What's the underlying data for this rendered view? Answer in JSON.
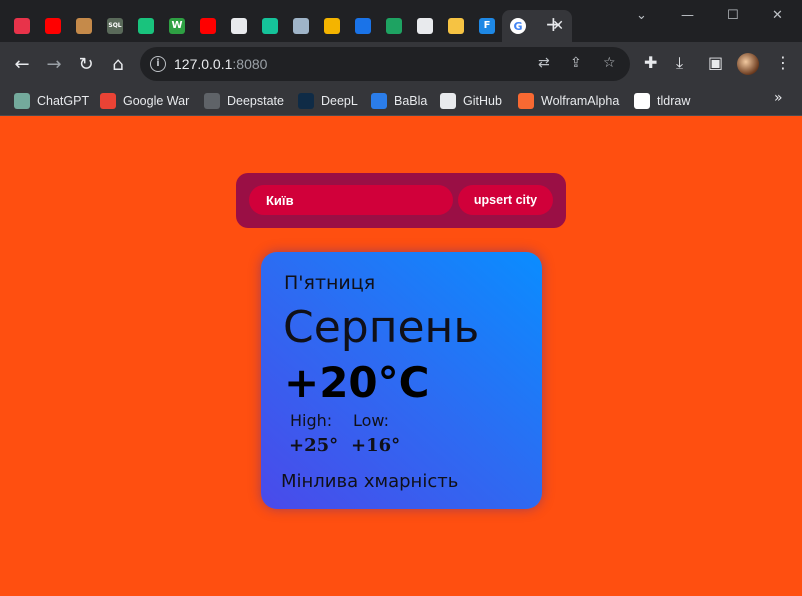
{
  "browser": {
    "tabs": [
      {
        "icon": "heart-icon",
        "color": "#e8334a"
      },
      {
        "icon": "youtube-icon",
        "color": "#ff0000"
      },
      {
        "icon": "box-icon",
        "color": "#c58a4a"
      },
      {
        "icon": "sql-icon",
        "color": "#5a6a5a",
        "glyph": "SQL"
      },
      {
        "icon": "openai-icon",
        "color": "#19c37d"
      },
      {
        "icon": "w-icon",
        "color": "#2ea043",
        "glyph": "W"
      },
      {
        "icon": "youtube-icon",
        "color": "#ff0000"
      },
      {
        "icon": "github-icon",
        "color": "#e8eaed"
      },
      {
        "icon": "health-icon",
        "color": "#15c39a"
      },
      {
        "icon": "qr-icon",
        "color": "#9fb4c8"
      },
      {
        "icon": "pinwheel-icon",
        "color": "#f4b400"
      },
      {
        "icon": "circle-icon",
        "color": "#1a73e8"
      },
      {
        "icon": "atom-icon",
        "color": "#1ea362"
      },
      {
        "icon": "chrome-icon",
        "color": "#e8eaed"
      },
      {
        "icon": "jar-icon",
        "color": "#f6c343"
      },
      {
        "icon": "f-icon",
        "color": "#1e88e5",
        "glyph": "F"
      }
    ],
    "active_tab_icon": "google-icon",
    "url_host": "127.0.0.1",
    "url_port": ":8080",
    "bookmarks": [
      {
        "label": "ChatGPT",
        "icon": "openai-icon",
        "color": "#74aa9c"
      },
      {
        "label": "Google War",
        "icon": "map-pin-icon",
        "color": "#ea4335"
      },
      {
        "label": "Deepstate",
        "icon": "deepstate-icon",
        "color": "#5f6368"
      },
      {
        "label": "DeepL",
        "icon": "deepl-icon",
        "color": "#0f2b46"
      },
      {
        "label": "BaBla",
        "icon": "babla-icon",
        "color": "#2b7de9"
      },
      {
        "label": "GitHub",
        "icon": "github-icon",
        "color": "#e8eaed"
      },
      {
        "label": "WolframAlpha",
        "icon": "wolfram-icon",
        "color": "#f96932"
      },
      {
        "label": "tldraw",
        "icon": "tldraw-icon",
        "color": "#ffffff"
      }
    ]
  },
  "app": {
    "city_input_value": "Київ",
    "upsert_label": "upsert city",
    "weather": {
      "day": "П'ятниця",
      "month": "Серпень",
      "temperature": "+20°C",
      "high_label": "High:",
      "low_label": "Low:",
      "high_value": "+25°",
      "low_value": "+16°",
      "description": "Мінлива хмарність"
    },
    "colors": {
      "background": "#ff4f10",
      "panel": "#9a0f45",
      "input": "#d1003a",
      "card_top": "#0a8dff",
      "card_bottom": "#4a4aea"
    }
  }
}
